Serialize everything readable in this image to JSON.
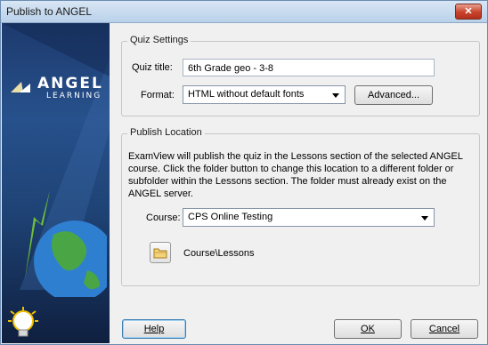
{
  "window": {
    "title": "Publish to ANGEL",
    "close_label": "✕"
  },
  "sidebar": {
    "logo_word": "ANGEL",
    "logo_sub": "LEARNING"
  },
  "quiz_settings": {
    "group_title": "Quiz Settings",
    "quiz_title_label": "Quiz title:",
    "quiz_title_value": "6th Grade geo - 3-8",
    "format_label": "Format:",
    "format_value": "HTML without default fonts",
    "advanced_button": "Advanced..."
  },
  "publish_location": {
    "group_title": "Publish Location",
    "description": "ExamView will publish the quiz in the Lessons section of the selected ANGEL course. Click the folder button to change this location to a different folder or subfolder within the Lessons section. The folder must already exist on the ANGEL server.",
    "course_label": "Course:",
    "course_value": "CPS Online Testing",
    "folder_path": "Course\\Lessons"
  },
  "buttons": {
    "help": "Help",
    "ok": "OK",
    "cancel": "Cancel"
  },
  "colors": {
    "sidebar": "#1d3a6e",
    "close": "#c8412a",
    "default_button_border": "#3c7fb1"
  }
}
